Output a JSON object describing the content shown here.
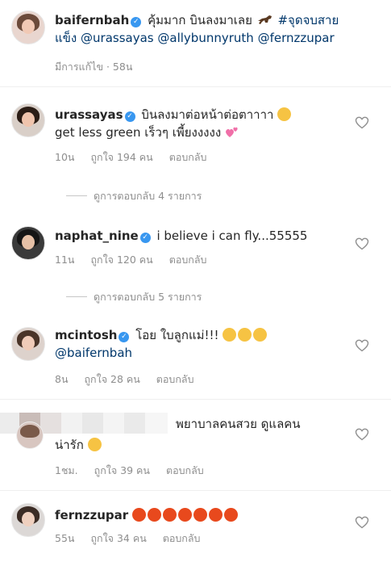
{
  "post": {
    "username": "baifernbah",
    "text": "คุ้มมาก บินลงมาเลย",
    "hashtag": "#จุดจบสายแข็ง",
    "mentions": [
      "@urassayas",
      "@allybunnyruth",
      "@fernzzupar"
    ],
    "meta": "มีการแก้ไข · 58น"
  },
  "comments": [
    {
      "username": "urassayas",
      "line1": "บินลงมาต่อหน้าต่อตาาาา",
      "line2": "get less green เร็วๆ เพี้ยงงงงง",
      "time": "10น",
      "likes": "ถูกใจ 194 คน",
      "reply": "ตอบกลับ",
      "view_replies": "ดูการตอบกลับ 4 รายการ"
    },
    {
      "username": "naphat_nine",
      "line1": "i believe i can fly...55555",
      "time": "11น",
      "likes": "ถูกใจ 120 คน",
      "reply": "ตอบกลับ",
      "view_replies": "ดูการตอบกลับ 5 รายการ"
    },
    {
      "username": "mcintosh",
      "line1": "โอย ใบลูกแม่!!!",
      "line2": "@baifernbah",
      "time": "8น",
      "likes": "ถูกใจ 28 คน",
      "reply": "ตอบกลับ"
    },
    {
      "username": "",
      "line1": "พยาบาลคนสวย ดูแลคน",
      "line2": "น่ารัก",
      "time": "1ชม.",
      "likes": "ถูกใจ 39 คน",
      "reply": "ตอบกลับ"
    },
    {
      "username": "fernzzupar",
      "time": "55น",
      "likes": "ถูกใจ 34 คน",
      "reply": "ตอบกลับ"
    }
  ],
  "icons": {
    "verified": "verified-badge-icon",
    "heart": "heart-outline-icon",
    "horse": "racehorse-emoji",
    "pleading": "pleading-face-emoji",
    "sweat": "downcast-sweat-emoji",
    "angry": "angry-face-emoji",
    "kiss": "kissing-heart-emoji",
    "hearts": "two-hearts-emoji"
  },
  "colors": {
    "verified": "#3897f0",
    "mention": "#00376b",
    "meta": "#8e8e8e"
  }
}
